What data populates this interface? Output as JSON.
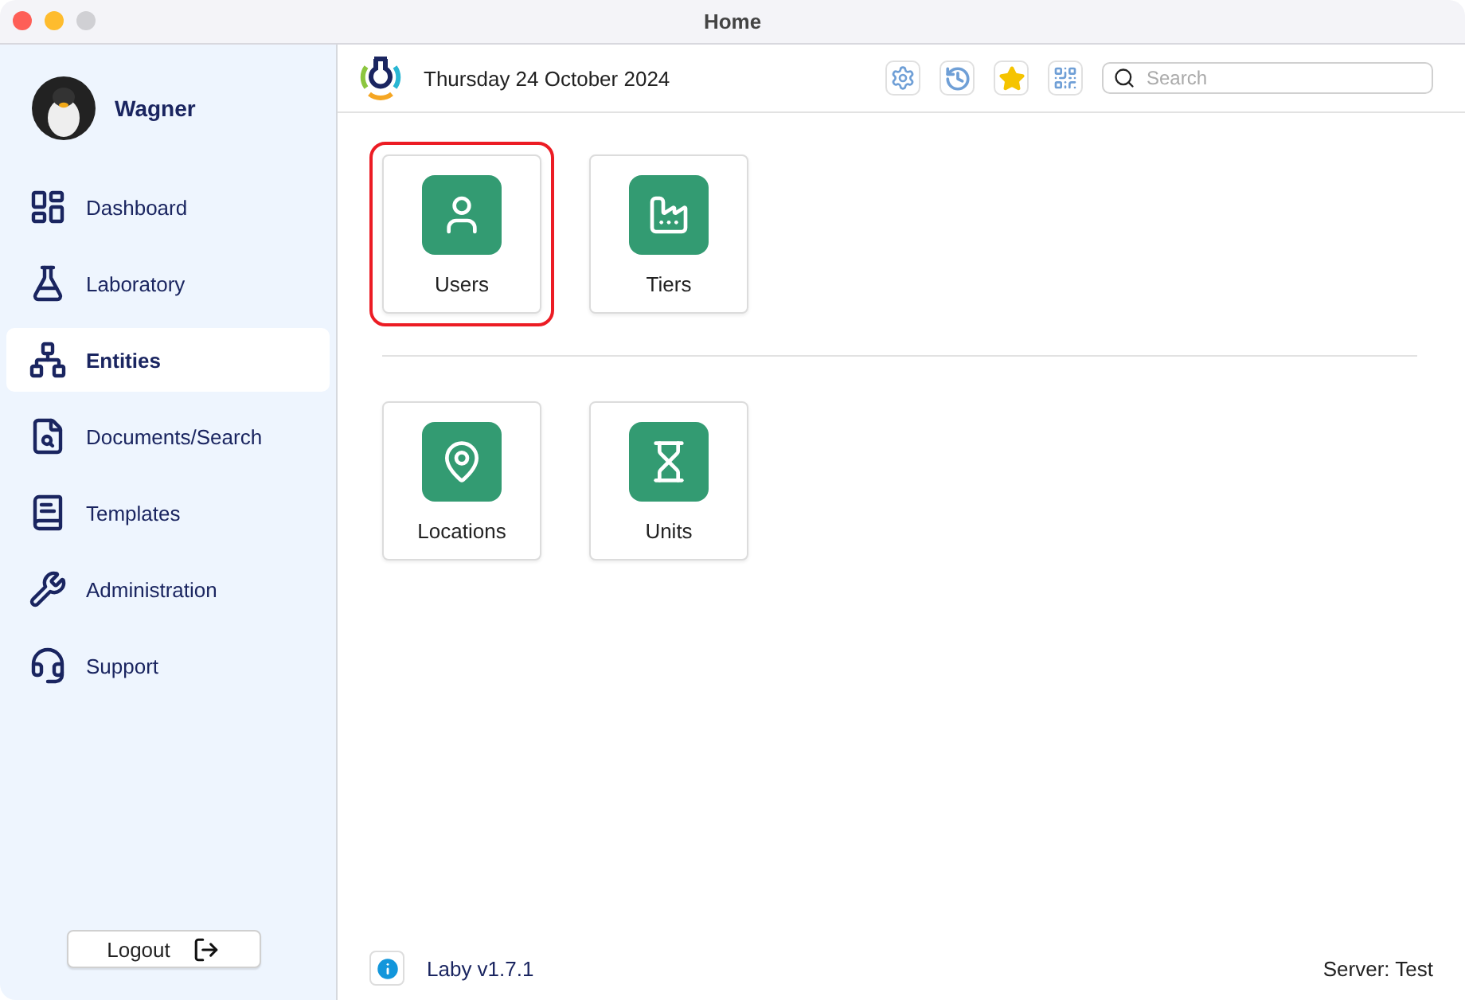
{
  "window": {
    "title": "Home"
  },
  "user": {
    "name": "Wagner"
  },
  "sidebar": {
    "items": [
      {
        "label": "Dashboard",
        "selected": false
      },
      {
        "label": "Laboratory",
        "selected": false
      },
      {
        "label": "Entities",
        "selected": true
      },
      {
        "label": "Documents/Search",
        "selected": false
      },
      {
        "label": "Templates",
        "selected": false
      },
      {
        "label": "Administration",
        "selected": false
      },
      {
        "label": "Support",
        "selected": false
      }
    ],
    "logout": "Logout"
  },
  "header": {
    "date": "Thursday 24 October 2024",
    "search": {
      "placeholder": "Search"
    }
  },
  "tile_groups": [
    [
      {
        "label": "Users",
        "selected": true
      },
      {
        "label": "Tiers",
        "selected": false
      }
    ],
    [
      {
        "label": "Locations",
        "selected": false
      },
      {
        "label": "Units",
        "selected": false
      }
    ]
  ],
  "footer": {
    "version": "Laby v1.7.1",
    "server": "Server: Test"
  }
}
